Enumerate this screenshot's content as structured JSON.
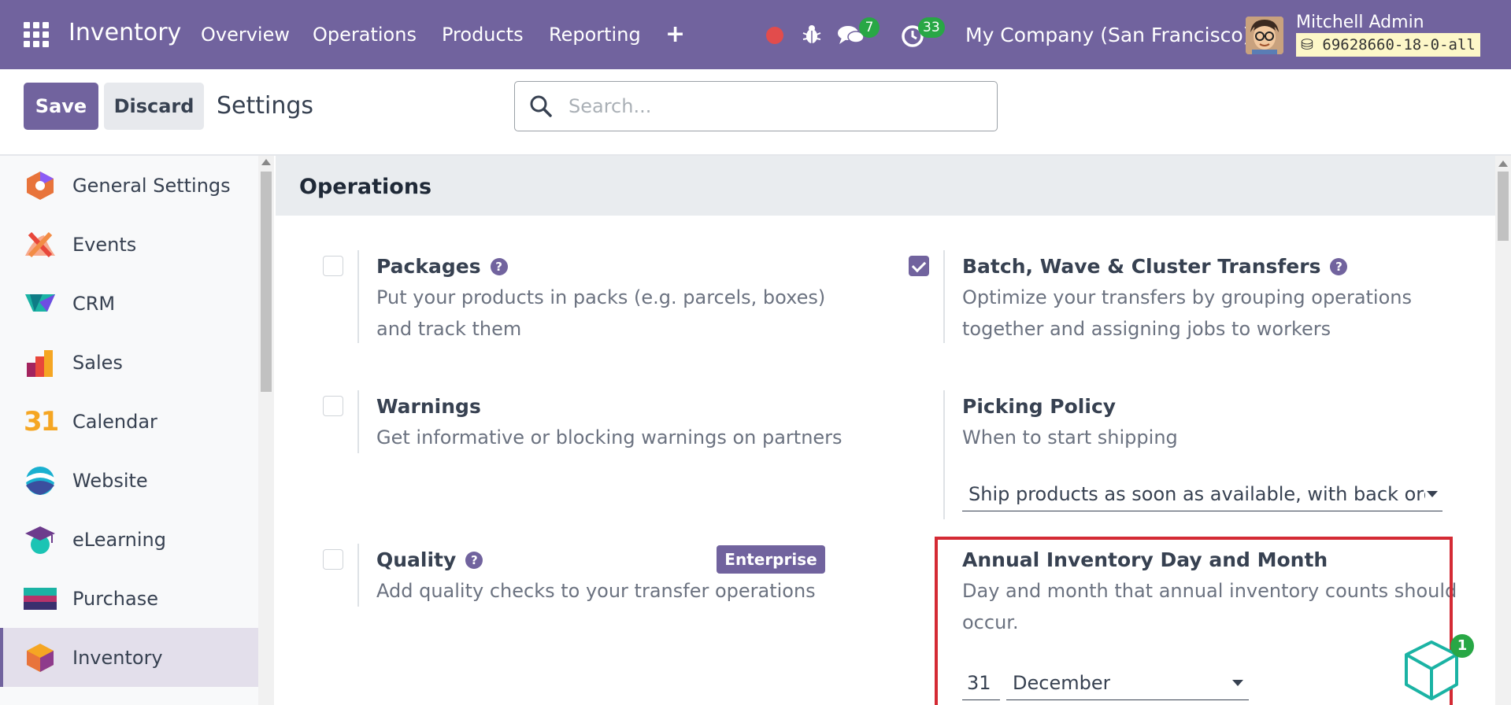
{
  "navbar": {
    "brand": "Inventory",
    "menu": [
      "Overview",
      "Operations",
      "Products",
      "Reporting"
    ],
    "plus_label": "+",
    "messages_count": "7",
    "activities_count": "33",
    "company": "My Company (San Francisco)",
    "user_name": "Mitchell Admin",
    "database": "69628660-18-0-all"
  },
  "controls": {
    "save_label": "Save",
    "discard_label": "Discard",
    "title": "Settings",
    "search_placeholder": "Search..."
  },
  "sidebar": {
    "items": [
      {
        "label": "General Settings",
        "icon": "general-settings-icon"
      },
      {
        "label": "Events",
        "icon": "events-icon"
      },
      {
        "label": "CRM",
        "icon": "crm-icon"
      },
      {
        "label": "Sales",
        "icon": "sales-icon"
      },
      {
        "label": "Calendar",
        "icon": "calendar-icon"
      },
      {
        "label": "Website",
        "icon": "website-icon"
      },
      {
        "label": "eLearning",
        "icon": "elearning-icon"
      },
      {
        "label": "Purchase",
        "icon": "purchase-icon"
      },
      {
        "label": "Inventory",
        "icon": "inventory-icon",
        "active": true
      }
    ],
    "calendar_glyph": "31"
  },
  "section": {
    "title": "Operations",
    "settings": {
      "packages": {
        "title": "Packages",
        "description": "Put your products in packs (e.g. parcels, boxes) and track them",
        "checked": false
      },
      "batch": {
        "title": "Batch, Wave & Cluster Transfers",
        "description": "Optimize your transfers by grouping operations together and assigning jobs to workers",
        "checked": true
      },
      "warnings": {
        "title": "Warnings",
        "description": "Get informative or blocking warnings on partners",
        "checked": false
      },
      "picking": {
        "title": "Picking Policy",
        "description": "When to start shipping",
        "value": "Ship products as soon as available, with back orders"
      },
      "quality": {
        "title": "Quality",
        "description": "Add quality checks to your transfer operations",
        "badge": "Enterprise",
        "checked": false
      },
      "annual": {
        "title": "Annual Inventory Day and Month",
        "description": "Day and month that annual inventory counts should occur.",
        "day": "31",
        "month": "December"
      }
    }
  },
  "onboarding": {
    "count": "1"
  },
  "colors": {
    "brand": "#71639e",
    "highlight": "#d42a34",
    "badge": "#28a745"
  }
}
